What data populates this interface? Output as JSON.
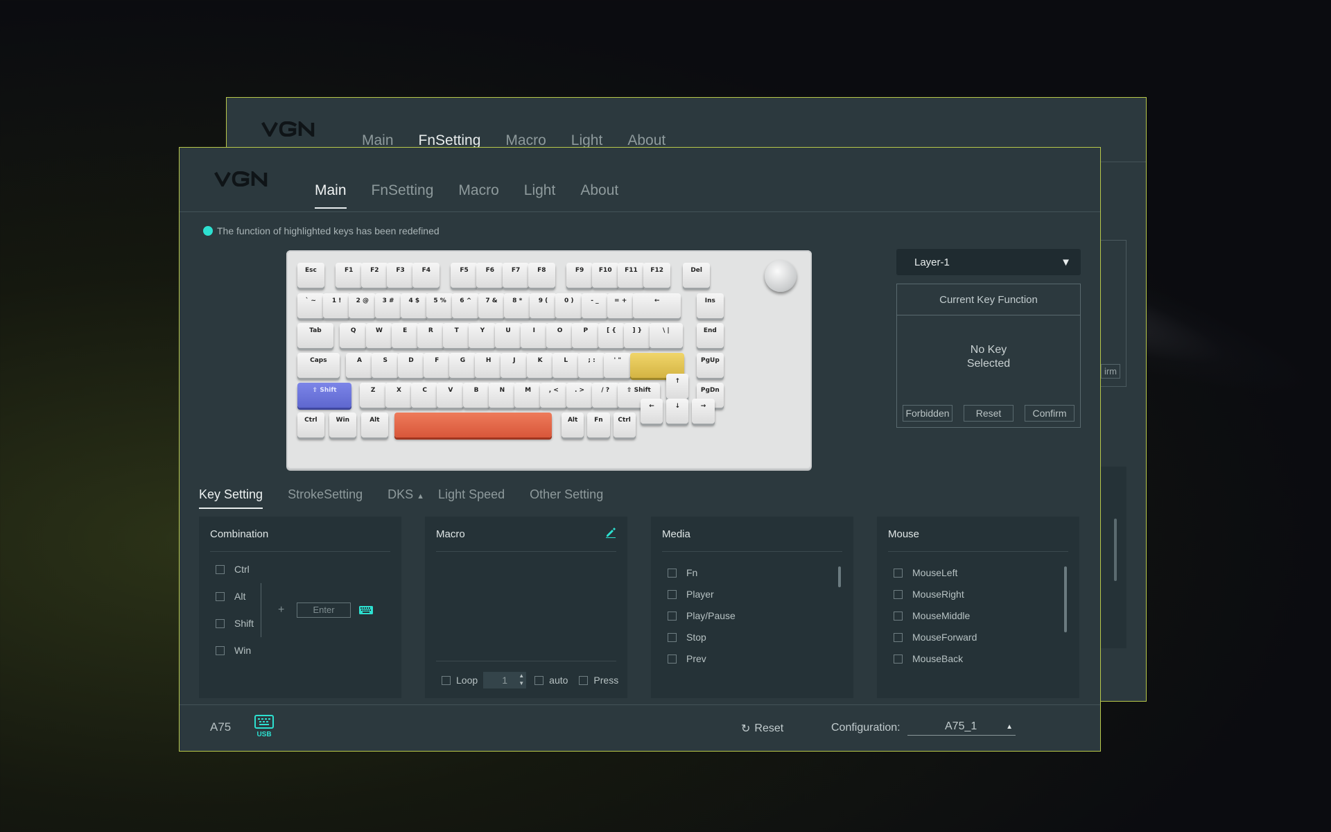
{
  "app": {
    "logo": "VGN"
  },
  "back_window": {
    "nav": [
      "Main",
      "FnSetting",
      "Macro",
      "Light",
      "About"
    ],
    "active_tab": "FnSetting",
    "partial_button": "irm"
  },
  "nav": {
    "tabs": [
      "Main",
      "FnSetting",
      "Macro",
      "Light",
      "About"
    ],
    "active": "Main"
  },
  "notice": "The function of highlighted keys has been redefined",
  "keyboard": {
    "rows": [
      [
        "Esc",
        "F1",
        "F2",
        "F3",
        "F4",
        "F5",
        "F6",
        "F7",
        "F8",
        "F9",
        "F10",
        "F11",
        "F12",
        "Del"
      ],
      [
        "` ~",
        "1 !",
        "2 @",
        "3 #",
        "4 $",
        "5 %",
        "6 ^",
        "7 &",
        "8 *",
        "9 (",
        "0 )",
        "- _",
        "= +",
        "←",
        "Ins"
      ],
      [
        "Tab",
        "Q",
        "W",
        "E",
        "R",
        "T",
        "Y",
        "U",
        "I",
        "O",
        "P",
        "[ {",
        "] }",
        "\\ |",
        "End"
      ],
      [
        "Caps",
        "A",
        "S",
        "D",
        "F",
        "G",
        "H",
        "J",
        "K",
        "L",
        "; :",
        "' \"",
        "",
        "PgUp"
      ],
      [
        "⇧ Shift",
        "Z",
        "X",
        "C",
        "V",
        "B",
        "N",
        "M",
        ", <",
        ". >",
        "/ ?",
        "⇧ Shift",
        "↑",
        "PgDn"
      ],
      [
        "Ctrl",
        "Win",
        "Alt",
        "",
        "Alt",
        "Fn",
        "Ctrl",
        "←",
        "↓",
        "→"
      ]
    ]
  },
  "layer": {
    "selected": "Layer-1",
    "arrow": "▼"
  },
  "current_key": {
    "title": "Current Key Function",
    "status_line1": "No Key",
    "status_line2": "Selected",
    "buttons": {
      "forbidden": "Forbidden",
      "reset": "Reset",
      "confirm": "Confirm"
    }
  },
  "subtabs": {
    "items": [
      "Key Setting",
      "StrokeSetting",
      "DKS",
      "Light Speed",
      "Other Setting"
    ],
    "active": "Key Setting"
  },
  "combination": {
    "title": "Combination",
    "mods": [
      "Ctrl",
      "Alt",
      "Shift",
      "Win"
    ],
    "plus": "+",
    "key_placeholder": "Enter"
  },
  "macro": {
    "title": "Macro",
    "loop_label": "Loop",
    "loop_value": "1",
    "auto_label": "auto",
    "press_label": "Press"
  },
  "media": {
    "title": "Media",
    "items": [
      "Fn",
      "Player",
      "Play/Pause",
      "Stop",
      "Prev"
    ]
  },
  "mouse": {
    "title": "Mouse",
    "items": [
      "MouseLeft",
      "MouseRight",
      "MouseMiddle",
      "MouseForward",
      "MouseBack"
    ]
  },
  "footer": {
    "model": "A75",
    "connection": "USB",
    "reset_label": "Reset",
    "config_label": "Configuration:",
    "config_value": "A75_1"
  },
  "colors": {
    "accent": "#2de0d0",
    "border": "#b9c94a",
    "window": "#2c393e"
  }
}
